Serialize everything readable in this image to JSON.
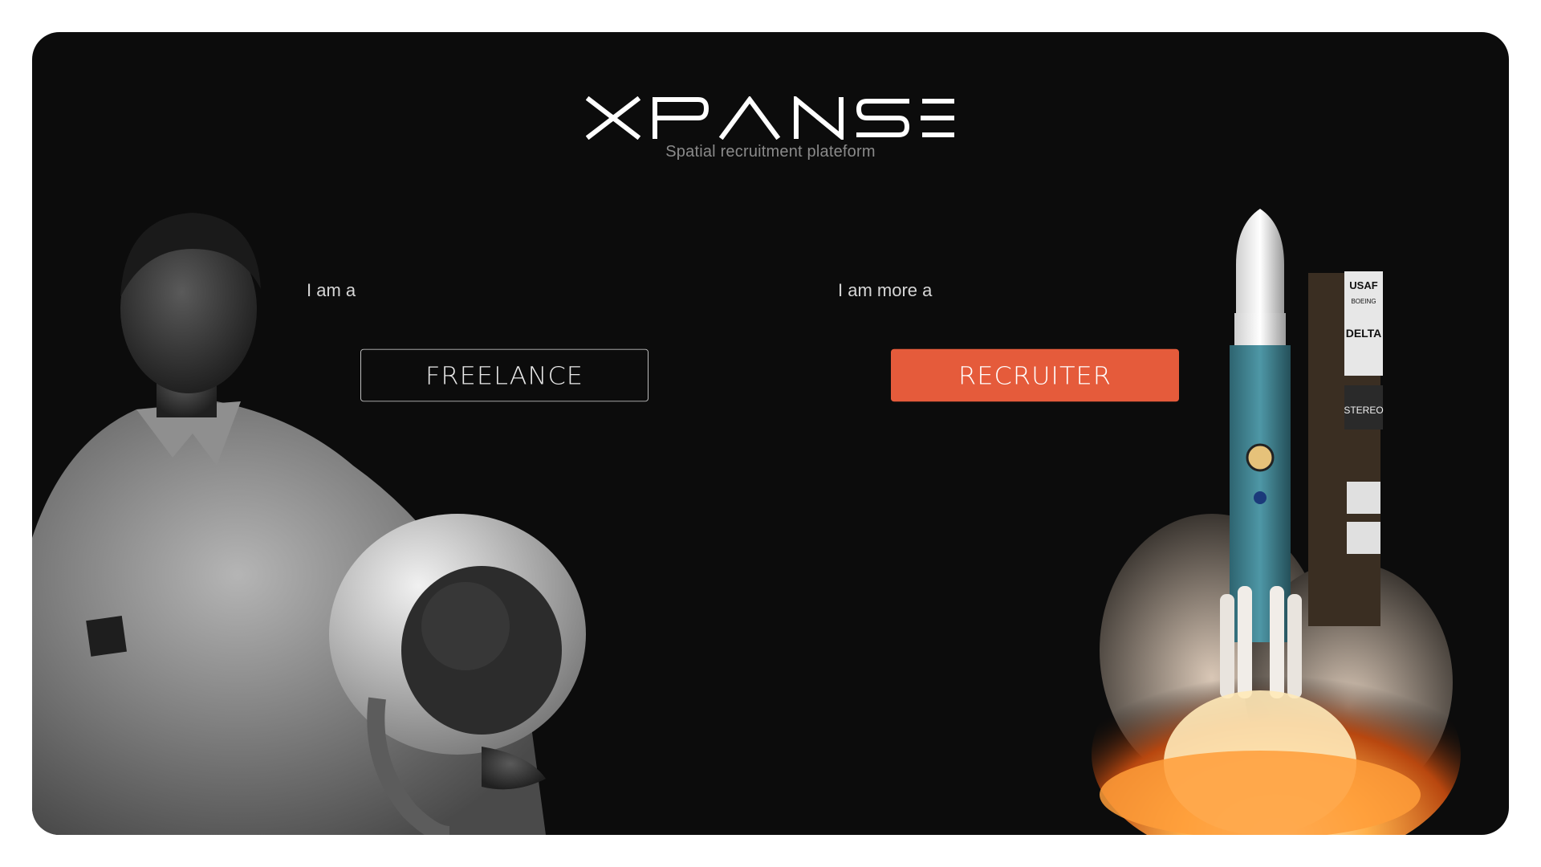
{
  "brand": {
    "name": "XPANSE",
    "tagline": "Spatial recruitment plateform"
  },
  "freelance": {
    "lead": "I am a",
    "button_label": "FREELANCE"
  },
  "recruiter": {
    "lead": "I am more a",
    "button_label": "RECRUITER"
  },
  "colors": {
    "background": "#0c0c0c",
    "accent": "#e55b3b",
    "page": "#ffffff"
  },
  "illustrations": {
    "left": "astronaut-with-helmet-photo",
    "right": "rocket-launch-photo"
  },
  "rocket_markings": [
    "USAF",
    "BOEING",
    "DELTA",
    "STEREO"
  ]
}
